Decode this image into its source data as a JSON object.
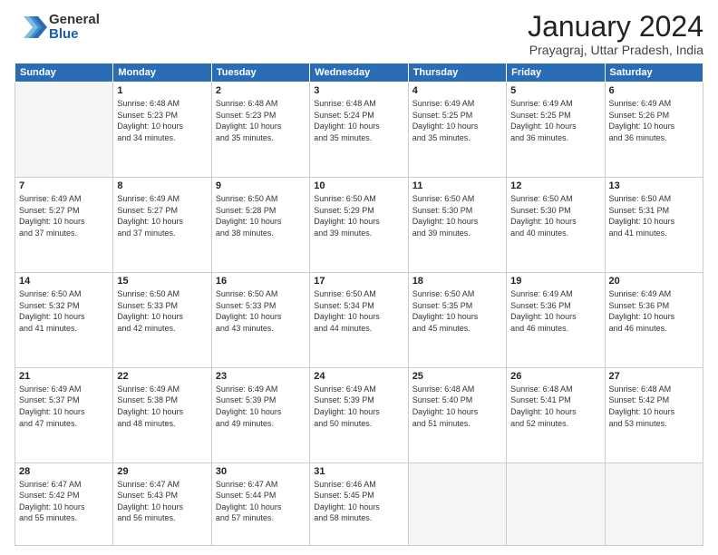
{
  "logo": {
    "general": "General",
    "blue": "Blue"
  },
  "header": {
    "month": "January 2024",
    "location": "Prayagraj, Uttar Pradesh, India"
  },
  "days": [
    "Sunday",
    "Monday",
    "Tuesday",
    "Wednesday",
    "Thursday",
    "Friday",
    "Saturday"
  ],
  "weeks": [
    [
      {
        "day": "",
        "info": ""
      },
      {
        "day": "1",
        "info": "Sunrise: 6:48 AM\nSunset: 5:23 PM\nDaylight: 10 hours\nand 34 minutes."
      },
      {
        "day": "2",
        "info": "Sunrise: 6:48 AM\nSunset: 5:23 PM\nDaylight: 10 hours\nand 35 minutes."
      },
      {
        "day": "3",
        "info": "Sunrise: 6:48 AM\nSunset: 5:24 PM\nDaylight: 10 hours\nand 35 minutes."
      },
      {
        "day": "4",
        "info": "Sunrise: 6:49 AM\nSunset: 5:25 PM\nDaylight: 10 hours\nand 35 minutes."
      },
      {
        "day": "5",
        "info": "Sunrise: 6:49 AM\nSunset: 5:25 PM\nDaylight: 10 hours\nand 36 minutes."
      },
      {
        "day": "6",
        "info": "Sunrise: 6:49 AM\nSunset: 5:26 PM\nDaylight: 10 hours\nand 36 minutes."
      }
    ],
    [
      {
        "day": "7",
        "info": "Sunrise: 6:49 AM\nSunset: 5:27 PM\nDaylight: 10 hours\nand 37 minutes."
      },
      {
        "day": "8",
        "info": "Sunrise: 6:49 AM\nSunset: 5:27 PM\nDaylight: 10 hours\nand 37 minutes."
      },
      {
        "day": "9",
        "info": "Sunrise: 6:50 AM\nSunset: 5:28 PM\nDaylight: 10 hours\nand 38 minutes."
      },
      {
        "day": "10",
        "info": "Sunrise: 6:50 AM\nSunset: 5:29 PM\nDaylight: 10 hours\nand 39 minutes."
      },
      {
        "day": "11",
        "info": "Sunrise: 6:50 AM\nSunset: 5:30 PM\nDaylight: 10 hours\nand 39 minutes."
      },
      {
        "day": "12",
        "info": "Sunrise: 6:50 AM\nSunset: 5:30 PM\nDaylight: 10 hours\nand 40 minutes."
      },
      {
        "day": "13",
        "info": "Sunrise: 6:50 AM\nSunset: 5:31 PM\nDaylight: 10 hours\nand 41 minutes."
      }
    ],
    [
      {
        "day": "14",
        "info": "Sunrise: 6:50 AM\nSunset: 5:32 PM\nDaylight: 10 hours\nand 41 minutes."
      },
      {
        "day": "15",
        "info": "Sunrise: 6:50 AM\nSunset: 5:33 PM\nDaylight: 10 hours\nand 42 minutes."
      },
      {
        "day": "16",
        "info": "Sunrise: 6:50 AM\nSunset: 5:33 PM\nDaylight: 10 hours\nand 43 minutes."
      },
      {
        "day": "17",
        "info": "Sunrise: 6:50 AM\nSunset: 5:34 PM\nDaylight: 10 hours\nand 44 minutes."
      },
      {
        "day": "18",
        "info": "Sunrise: 6:50 AM\nSunset: 5:35 PM\nDaylight: 10 hours\nand 45 minutes."
      },
      {
        "day": "19",
        "info": "Sunrise: 6:49 AM\nSunset: 5:36 PM\nDaylight: 10 hours\nand 46 minutes."
      },
      {
        "day": "20",
        "info": "Sunrise: 6:49 AM\nSunset: 5:36 PM\nDaylight: 10 hours\nand 46 minutes."
      }
    ],
    [
      {
        "day": "21",
        "info": "Sunrise: 6:49 AM\nSunset: 5:37 PM\nDaylight: 10 hours\nand 47 minutes."
      },
      {
        "day": "22",
        "info": "Sunrise: 6:49 AM\nSunset: 5:38 PM\nDaylight: 10 hours\nand 48 minutes."
      },
      {
        "day": "23",
        "info": "Sunrise: 6:49 AM\nSunset: 5:39 PM\nDaylight: 10 hours\nand 49 minutes."
      },
      {
        "day": "24",
        "info": "Sunrise: 6:49 AM\nSunset: 5:39 PM\nDaylight: 10 hours\nand 50 minutes."
      },
      {
        "day": "25",
        "info": "Sunrise: 6:48 AM\nSunset: 5:40 PM\nDaylight: 10 hours\nand 51 minutes."
      },
      {
        "day": "26",
        "info": "Sunrise: 6:48 AM\nSunset: 5:41 PM\nDaylight: 10 hours\nand 52 minutes."
      },
      {
        "day": "27",
        "info": "Sunrise: 6:48 AM\nSunset: 5:42 PM\nDaylight: 10 hours\nand 53 minutes."
      }
    ],
    [
      {
        "day": "28",
        "info": "Sunrise: 6:47 AM\nSunset: 5:42 PM\nDaylight: 10 hours\nand 55 minutes."
      },
      {
        "day": "29",
        "info": "Sunrise: 6:47 AM\nSunset: 5:43 PM\nDaylight: 10 hours\nand 56 minutes."
      },
      {
        "day": "30",
        "info": "Sunrise: 6:47 AM\nSunset: 5:44 PM\nDaylight: 10 hours\nand 57 minutes."
      },
      {
        "day": "31",
        "info": "Sunrise: 6:46 AM\nSunset: 5:45 PM\nDaylight: 10 hours\nand 58 minutes."
      },
      {
        "day": "",
        "info": ""
      },
      {
        "day": "",
        "info": ""
      },
      {
        "day": "",
        "info": ""
      }
    ]
  ]
}
